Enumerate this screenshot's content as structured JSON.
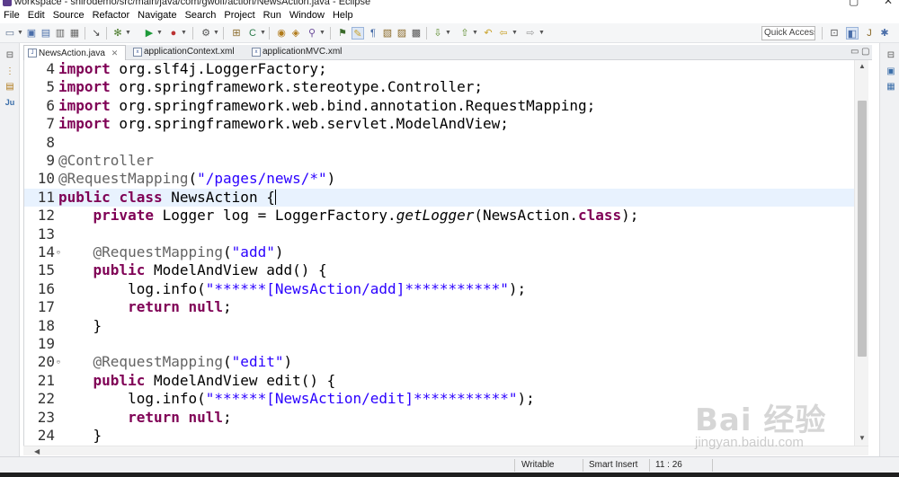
{
  "window": {
    "title": "workspace - shirodemo/src/main/java/com/gwolf/action/NewsAction.java - Eclipse"
  },
  "menu": [
    "File",
    "Edit",
    "Source",
    "Refactor",
    "Navigate",
    "Search",
    "Project",
    "Run",
    "Window",
    "Help"
  ],
  "toolbar": {
    "quick_access_label": "Quick Access"
  },
  "tabs": [
    {
      "label": "NewsAction.java",
      "active": true
    },
    {
      "label": "applicationContext.xml",
      "active": false
    },
    {
      "label": "applicationMVC.xml",
      "active": false
    }
  ],
  "editor": {
    "lines": [
      {
        "n": "4",
        "code": "import org.slf4j.LoggerFactory;"
      },
      {
        "n": "5",
        "code": "import org.springframework.stereotype.Controller;"
      },
      {
        "n": "6",
        "code": "import org.springframework.web.bind.annotation.RequestMapping;"
      },
      {
        "n": "7",
        "code": "import org.springframework.web.servlet.ModelAndView;"
      },
      {
        "n": "8",
        "code": ""
      },
      {
        "n": "9",
        "code": "@Controller"
      },
      {
        "n": "10",
        "code": "@RequestMapping(\"/pages/news/*\")"
      },
      {
        "n": "11",
        "code": "public class NewsAction {"
      },
      {
        "n": "12",
        "code": "    private Logger log = LoggerFactory.getLogger(NewsAction.class);"
      },
      {
        "n": "13",
        "code": ""
      },
      {
        "n": "14",
        "code": "    @RequestMapping(\"add\")"
      },
      {
        "n": "15",
        "code": "    public ModelAndView add() {"
      },
      {
        "n": "16",
        "code": "        log.info(\"******[NewsAction/add]***********\");"
      },
      {
        "n": "17",
        "code": "        return null;"
      },
      {
        "n": "18",
        "code": "    }"
      },
      {
        "n": "19",
        "code": ""
      },
      {
        "n": "20",
        "code": "    @RequestMapping(\"edit\")"
      },
      {
        "n": "21",
        "code": "    public ModelAndView edit() {"
      },
      {
        "n": "22",
        "code": "        log.info(\"******[NewsAction/edit]***********\");"
      },
      {
        "n": "23",
        "code": "        return null;"
      },
      {
        "n": "24",
        "code": "    }"
      }
    ],
    "current_line": "11"
  },
  "status": {
    "writable": "Writable",
    "insert_mode": "Smart Insert",
    "position": "11 : 26"
  },
  "watermark": {
    "logo": "Bai 经验",
    "url": "jingyan.baidu.com"
  },
  "colors": {
    "keyword": "#7f0055",
    "string": "#2a00ff",
    "annotation": "#646464",
    "current_line_bg": "#e8f2fe"
  }
}
